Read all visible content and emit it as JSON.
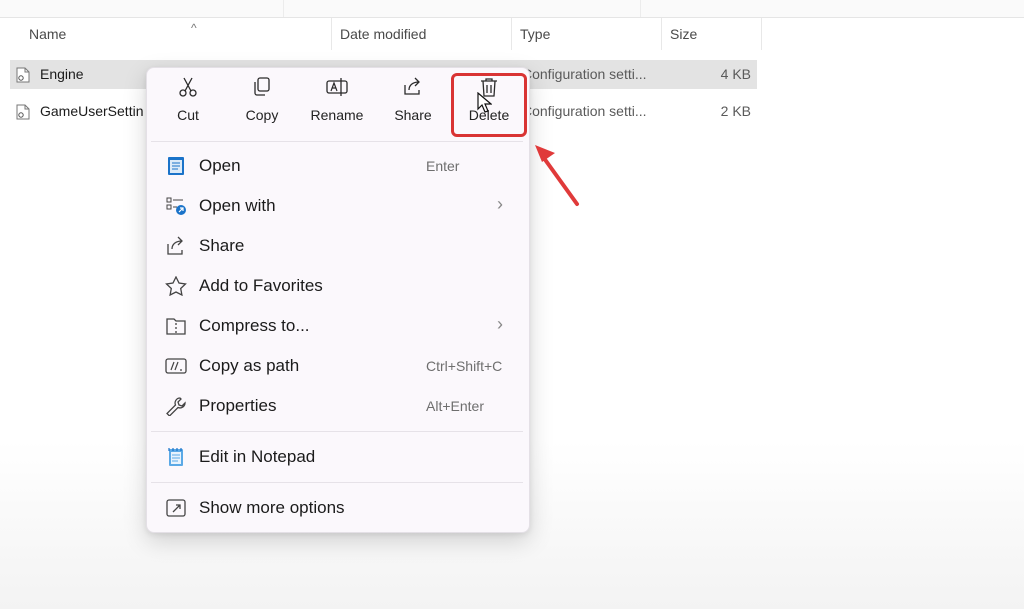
{
  "columns": {
    "name": "Name",
    "date": "Date modified",
    "type": "Type",
    "size": "Size"
  },
  "files": [
    {
      "name": "Engine",
      "type": "Configuration setti...",
      "size": "4 KB",
      "selected": true
    },
    {
      "name": "GameUserSettin",
      "type": "Configuration setti...",
      "size": "2 KB",
      "selected": false
    }
  ],
  "quick_actions": [
    {
      "label": "Cut",
      "icon": "scissors-icon"
    },
    {
      "label": "Copy",
      "icon": "copy-icon"
    },
    {
      "label": "Rename",
      "icon": "rename-icon"
    },
    {
      "label": "Share",
      "icon": "share-icon"
    },
    {
      "label": "Delete",
      "icon": "trash-icon",
      "highlighted": true
    }
  ],
  "menu_items": [
    {
      "label": "Open",
      "shortcut": "Enter",
      "icon": "notepad-icon"
    },
    {
      "label": "Open with",
      "icon": "open-with-icon",
      "submenu": true
    },
    {
      "label": "Share",
      "icon": "share-icon"
    },
    {
      "label": "Add to Favorites",
      "icon": "star-icon"
    },
    {
      "label": "Compress to...",
      "icon": "zip-folder-icon",
      "submenu": true
    },
    {
      "label": "Copy as path",
      "shortcut": "Ctrl+Shift+C",
      "icon": "path-icon"
    },
    {
      "label": "Properties",
      "shortcut": "Alt+Enter",
      "icon": "wrench-icon"
    },
    {
      "label": "Edit in Notepad",
      "icon": "notepad-icon"
    },
    {
      "label": "Show more options",
      "icon": "expand-icon"
    }
  ],
  "colors": {
    "highlight": "#d93434",
    "accent": "#1a73c9",
    "selected_row": "#e3e3e3"
  }
}
